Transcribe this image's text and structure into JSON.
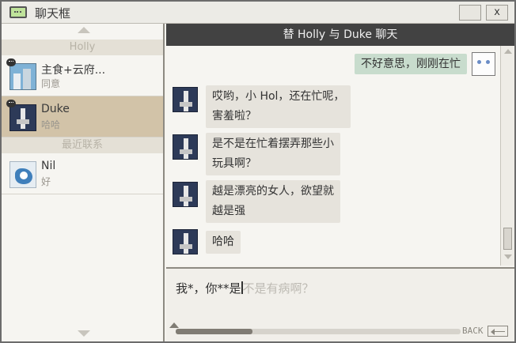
{
  "window": {
    "title": "聊天框",
    "close_label": "x"
  },
  "sidebar": {
    "section_holly": "Holly",
    "section_recent": "最近联系",
    "contacts": [
      {
        "name": "主食+云府...",
        "sub": "同意",
        "avatar": "city-avatar",
        "selected": false
      },
      {
        "name": "Duke",
        "sub": "哈哈",
        "avatar": "duke-avatar",
        "selected": true
      },
      {
        "name": "Nil",
        "sub": "好",
        "avatar": "nil-avatar",
        "selected": false
      }
    ]
  },
  "chat": {
    "header": "替 Holly 与 Duke 聊天",
    "outgoing": [
      {
        "text": "不好意思，刚刚在忙"
      }
    ],
    "incoming": [
      {
        "line1": "哎哟，小 Hol，还在忙呢，",
        "line2": "害羞啦？"
      },
      {
        "line1": "是不是在忙着摆弄那些小",
        "line2": "玩具啊？"
      },
      {
        "line1": "越是漂亮的女人，欲望就",
        "line2": "越是强"
      },
      {
        "line1": "哈哈",
        "line2": ""
      }
    ]
  },
  "input": {
    "typed_text": "我*，你**是",
    "ghost_text": "不是有病啊？",
    "progress_fraction": 0.27,
    "back_label": "BACK"
  },
  "colors": {
    "header_bg": "#424242",
    "selected_contact": "#d2c3a8",
    "outgoing_bubble": "#c8dccd",
    "incoming_bubble": "#e6e3dc"
  }
}
